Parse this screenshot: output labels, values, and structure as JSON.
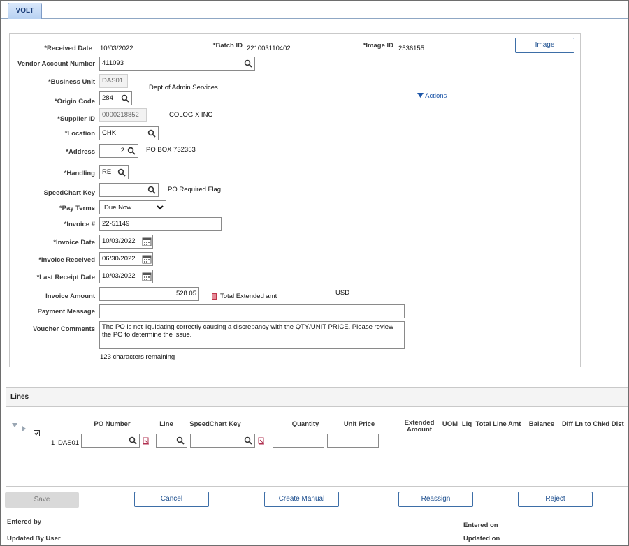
{
  "tab": {
    "label": "VOLT"
  },
  "header": {
    "received_date_label": "*Received Date",
    "received_date": "10/03/2022",
    "batch_id_label": "*Batch ID",
    "batch_id": "221003110402",
    "image_id_label": "*Image ID",
    "image_id": "2536155",
    "image_button": "Image",
    "vendor_account_label": "Vendor Account Number",
    "vendor_account": "411093",
    "business_unit_label": "*Business Unit",
    "business_unit": "DAS01",
    "business_unit_desc": "Dept of Admin Services",
    "origin_code_label": "*Origin Code",
    "origin_code": "284",
    "actions_label": "Actions",
    "supplier_id_label": "*Supplier ID",
    "supplier_id": "0000218852",
    "supplier_name": "COLOGIX INC",
    "location_label": "*Location",
    "location": "CHK",
    "address_label": "*Address",
    "address": "2",
    "address_desc": "PO BOX 732353",
    "handling_label": "*Handling",
    "handling": "RE",
    "speedchart_label": "SpeedChart Key",
    "speedchart": "",
    "po_required_flag": "PO Required Flag",
    "pay_terms_label": "*Pay Terms",
    "pay_terms": "Due Now",
    "invoice_no_label": "*Invoice #",
    "invoice_no": "22-51149",
    "invoice_date_label": "*Invoice Date",
    "invoice_date": "10/03/2022",
    "invoice_received_label": "*Invoice Received",
    "invoice_received": "06/30/2022",
    "last_receipt_label": "*Last Receipt Date",
    "last_receipt": "10/03/2022",
    "invoice_amount_label": "Invoice Amount",
    "invoice_amount": "528.05",
    "total_extended_label": "Total Extended amt",
    "currency": "USD",
    "payment_message_label": "Payment Message",
    "payment_message": "",
    "voucher_comments_label": "Voucher Comments",
    "voucher_comments": "The PO is not liquidating correctly causing a discrepancy with the QTY/UNIT PRICE. Please review the PO to determine the issue.",
    "chars_remaining": "123 characters remaining"
  },
  "lines": {
    "title": "Lines",
    "columns": {
      "po_number": "PO Number",
      "line": "Line",
      "speedchart": "SpeedChart Key",
      "quantity": "Quantity",
      "unit_price": "Unit Price",
      "extended_amount": "Extended Amount",
      "uom": "UOM",
      "liq": "Liq",
      "total_line_amt": "Total Line Amt",
      "balance": "Balance",
      "diff": "Diff Ln to Chkd Dist"
    },
    "row": {
      "num": "1",
      "bu": "DAS01",
      "po_number": "",
      "line": "",
      "speedchart": "",
      "quantity": "",
      "unit_price": "",
      "checked": true
    }
  },
  "buttons": {
    "save": "Save",
    "cancel": "Cancel",
    "create_manual": "Create Manual",
    "reassign": "Reassign",
    "reject": "Reject"
  },
  "footer": {
    "entered_by": "Entered by",
    "updated_by": "Updated By User",
    "entered_on": "Entered on",
    "updated_on": "Updated on"
  },
  "colors": {
    "link": "#1d56a8",
    "button_border": "#3d6ea7",
    "tab_bg": "#c6dbf6"
  }
}
